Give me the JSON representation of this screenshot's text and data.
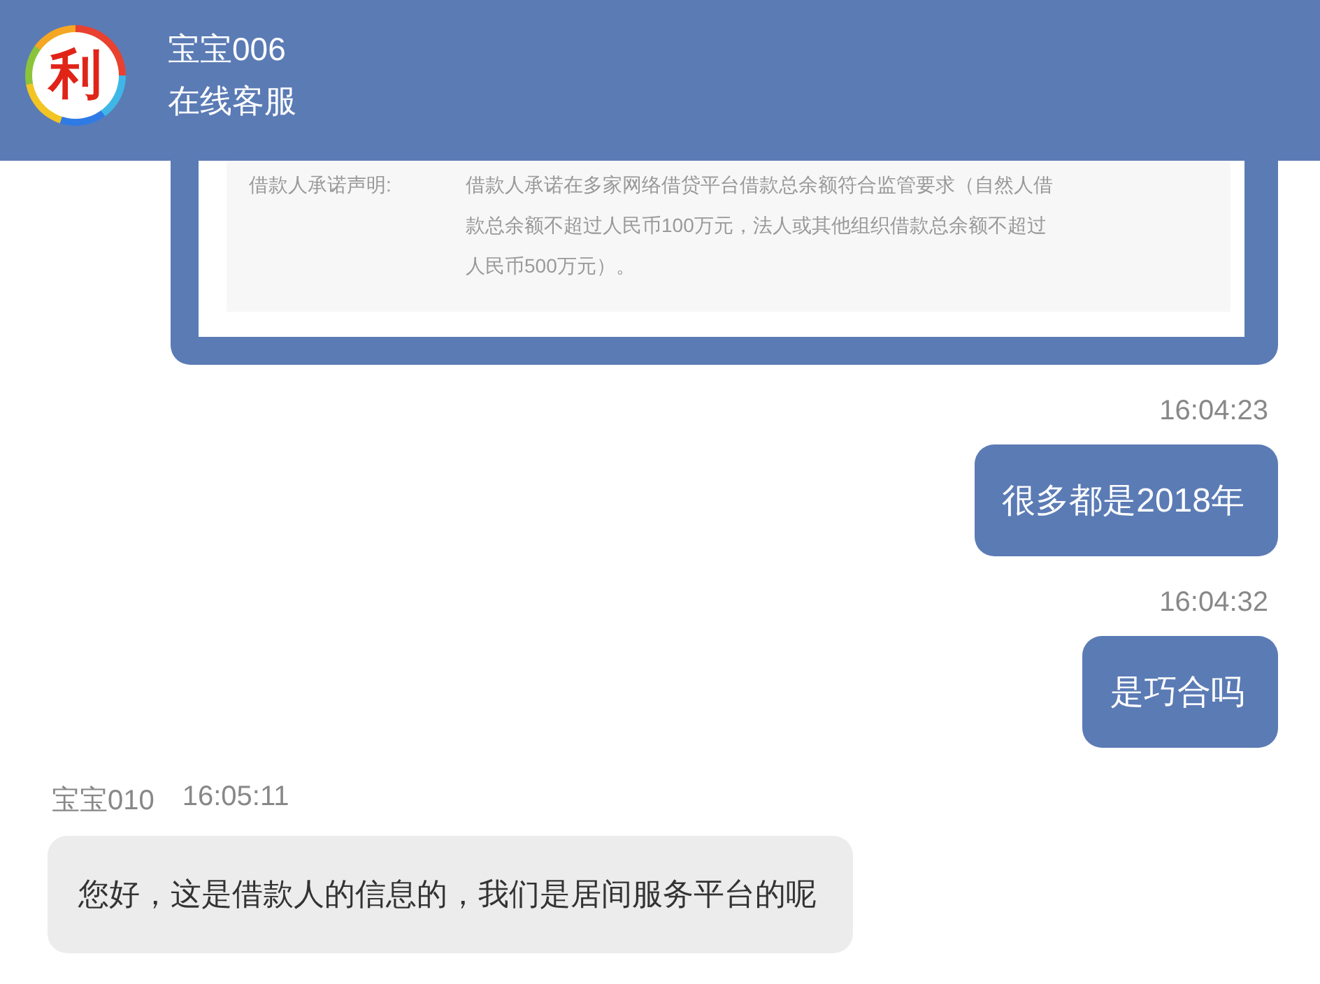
{
  "header": {
    "logo_text": "利",
    "name": "宝宝006",
    "subtitle": "在线客服"
  },
  "messages": [
    {
      "kind": "document",
      "outgoing": true,
      "label": "借款人承诺声明:",
      "text": "借款人承诺在多家网络借贷平台借款总余额符合监管要求（自然人借款总余额不超过人民币100万元，法人或其他组织借款总余额不超过人民币500万元）。"
    },
    {
      "kind": "time",
      "outgoing": true,
      "text": "16:04:23"
    },
    {
      "kind": "text",
      "outgoing": true,
      "text": "很多都是2018年"
    },
    {
      "kind": "time",
      "outgoing": true,
      "text": "16:04:32"
    },
    {
      "kind": "text",
      "outgoing": true,
      "text": "是巧合吗"
    },
    {
      "kind": "sender",
      "outgoing": false,
      "name": "宝宝010",
      "time": "16:05:11"
    },
    {
      "kind": "text",
      "outgoing": false,
      "text": "您好，这是借款人的信息的，我们是居间服务平台的呢"
    }
  ]
}
